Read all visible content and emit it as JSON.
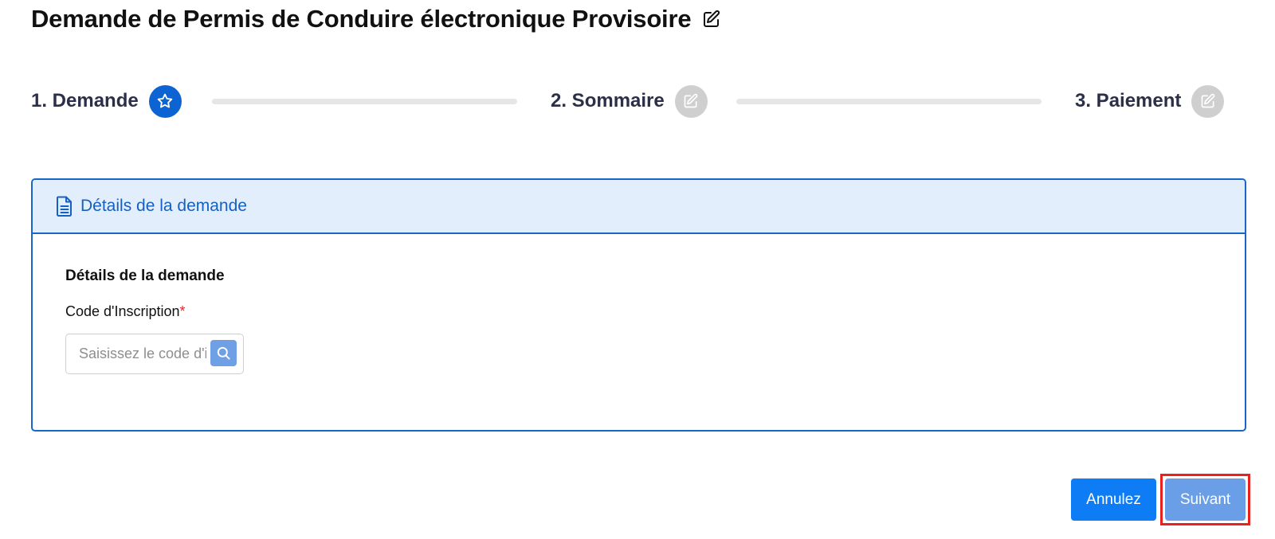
{
  "page": {
    "title": "Demande de Permis de Conduire électronique Provisoire",
    "title_icon": "edit-icon"
  },
  "stepper": {
    "steps": [
      {
        "label": "1. Demande",
        "icon": "star-icon",
        "state": "active"
      },
      {
        "label": "2. Sommaire",
        "icon": "edit-icon",
        "state": "inactive"
      },
      {
        "label": "3. Paiement",
        "icon": "edit-icon",
        "state": "inactive"
      }
    ]
  },
  "card": {
    "header_title": "Détails de la demande",
    "header_icon": "document-icon",
    "section_title": "Détails de la demande",
    "field_label": "Code d'Inscription",
    "required_mark": "*",
    "search_placeholder": "Saisissez le code d'inscription",
    "search_value": "",
    "search_icon": "search-icon"
  },
  "actions": {
    "cancel_label": "Annulez",
    "next_label": "Suivant"
  },
  "colors": {
    "primary": "#0d63d1",
    "step_inactive": "#cfcfcf",
    "card_border": "#1a66c8",
    "card_header_bg": "#e2eefb",
    "cancel_button": "#0d7cf5",
    "next_button": "#6a9fe8",
    "highlight": "#e8231f",
    "required": "#e0262d"
  }
}
